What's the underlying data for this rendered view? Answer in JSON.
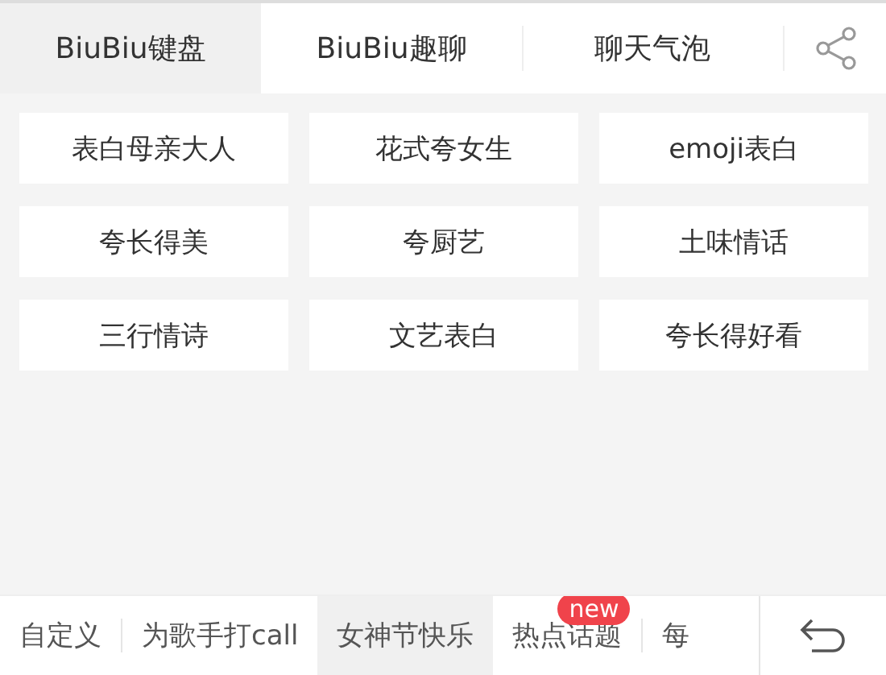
{
  "top_tabs": [
    {
      "label": "BiuBiu键盘",
      "selected": true
    },
    {
      "label": "BiuBiu趣聊",
      "selected": false
    },
    {
      "label": "聊天气泡",
      "selected": false
    }
  ],
  "phrases": [
    "表白母亲大人",
    "花式夸女生",
    "emoji表白",
    "夸长得美",
    "夸厨艺",
    "土味情话",
    "三行情诗",
    "文艺表白",
    "夸长得好看"
  ],
  "bottom_tabs": [
    {
      "label": "自定义",
      "selected": false
    },
    {
      "label": "为歌手打call",
      "selected": false
    },
    {
      "label": "女神节快乐",
      "selected": true
    },
    {
      "label": "热点话题",
      "selected": false,
      "badge": "new"
    },
    {
      "label": "每",
      "selected": false
    }
  ]
}
